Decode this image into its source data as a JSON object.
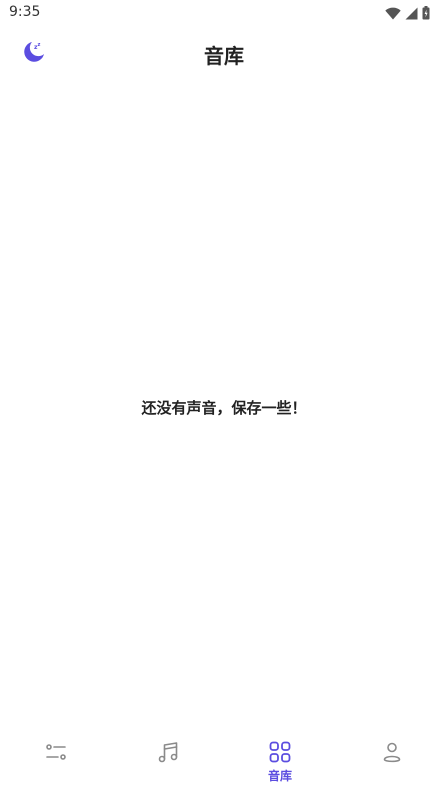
{
  "status_bar": {
    "time": "9:35",
    "icons": [
      "wifi-icon",
      "signal-icon",
      "battery-icon"
    ]
  },
  "header": {
    "title": "音库",
    "left_icon": "sleep-moon-icon"
  },
  "main": {
    "empty_message": "还没有声音，保存一些！"
  },
  "bottom_nav": {
    "items": [
      {
        "icon": "sliders-icon",
        "label": "",
        "active": false
      },
      {
        "icon": "music-note-icon",
        "label": "",
        "active": false
      },
      {
        "icon": "grid-icon",
        "label": "音库",
        "active": true
      },
      {
        "icon": "profile-icon",
        "label": "",
        "active": false
      }
    ]
  },
  "colors": {
    "accent": "#5b4de0",
    "inactive_icon": "#8a8a8a",
    "text": "#222222"
  }
}
